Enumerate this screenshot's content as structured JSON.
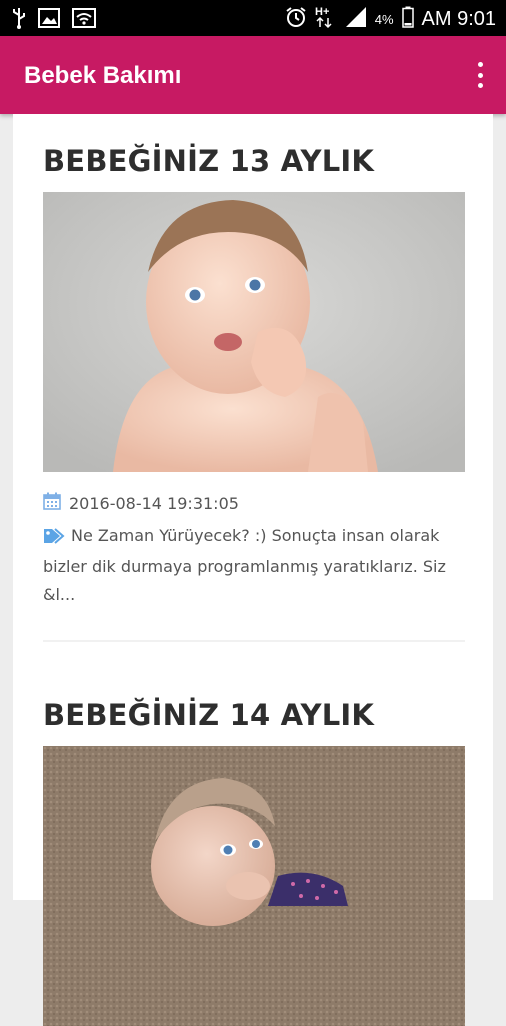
{
  "status_bar": {
    "battery": "4%",
    "time": "AM 9:01",
    "icons": [
      "usb-icon",
      "image-icon",
      "wifi-icon",
      "alarm-icon",
      "hplus-signal-icon",
      "signal-icon",
      "battery-icon"
    ]
  },
  "app_bar": {
    "title": "Bebek Bakımı",
    "menu_icon": "overflow-menu-icon",
    "color": "#c71a63"
  },
  "posts": [
    {
      "title": "BEBEĞİNİZ 13 AYLIK",
      "date": "2016-08-14 19:31:05",
      "excerpt": "Ne Zaman Yürüyecek? :)  Sonuçta insan olarak bizler dik durmaya programlanmış yaratıklarız. Siz &l..."
    },
    {
      "title": "BEBEĞİNİZ 14 AYLIK"
    }
  ]
}
